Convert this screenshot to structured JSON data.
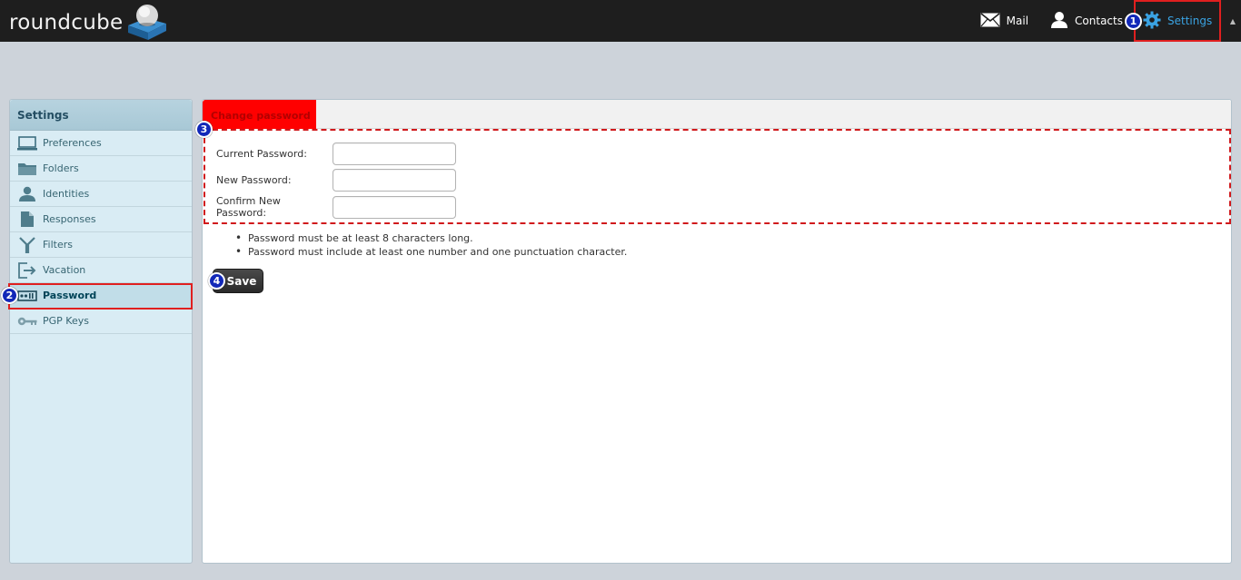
{
  "app": {
    "logo_text": "roundcube"
  },
  "topnav": {
    "mail_label": "Mail",
    "contacts_label": "Contacts",
    "settings_label": "Settings",
    "settings_badge": "1"
  },
  "sidebar": {
    "title": "Settings",
    "items": [
      {
        "label": "Preferences",
        "icon": "monitor-icon"
      },
      {
        "label": "Folders",
        "icon": "folder-icon"
      },
      {
        "label": "Identities",
        "icon": "person-icon"
      },
      {
        "label": "Responses",
        "icon": "document-icon"
      },
      {
        "label": "Filters",
        "icon": "filter-icon"
      },
      {
        "label": "Vacation",
        "icon": "exit-icon"
      },
      {
        "label": "Password",
        "icon": "password-icon",
        "selected": true,
        "badge": "2"
      },
      {
        "label": "PGP Keys",
        "icon": "key-icon"
      }
    ]
  },
  "main": {
    "tab_label": "Change password",
    "form_badge": "3",
    "fields": [
      {
        "label": "Current Password:",
        "value": ""
      },
      {
        "label": "New Password:",
        "value": ""
      },
      {
        "label": "Confirm New Password:",
        "value": ""
      }
    ],
    "rules": [
      "Password must be at least 8 characters long.",
      "Password must include at least one number and one punctuation character."
    ],
    "save_label": "Save",
    "save_badge": "4"
  },
  "colors": {
    "topbar_bg": "#1e1e1e",
    "accent_blue": "#3aa3e3",
    "highlight_red": "#e01f1f",
    "badge_blue": "#1228b8",
    "sidebar_bg": "#d9ecf4"
  }
}
